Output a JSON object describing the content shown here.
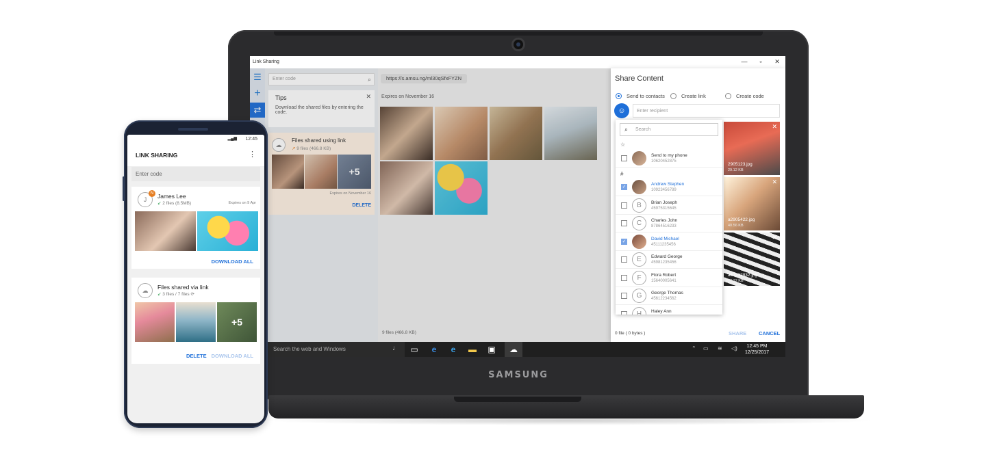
{
  "laptop": {
    "brand": "SAMSUNG",
    "window_title": "Link Sharing",
    "window_controls": {
      "minimize": "—",
      "maximize": "▫",
      "close": "✕"
    },
    "left_pane": {
      "code_placeholder": "Enter code",
      "tips_title": "Tips",
      "tips_text": "Download the shared files by entering the code.",
      "shared_card": {
        "title": "Files shared using link",
        "sub": "9 files (466.8 KB)",
        "more_count": "+5",
        "expires": "Expires on November 16",
        "delete_label": "DELETE"
      }
    },
    "center_pane": {
      "url": "https://s.amsu.ng/ml30qSfxFYZN",
      "expires": "Expires on November 16",
      "footer": "9 files (466.8 KB)"
    },
    "share_panel": {
      "title": "Share Content",
      "options": [
        "Send to contacts",
        "Create link",
        "Create code"
      ],
      "selected_option": "Send to contacts",
      "recipient_placeholder": "Enter recipient",
      "files": [
        {
          "name": "2905123.jpg",
          "size": "29.12 KB"
        },
        {
          "name": "a2905422.jpg",
          "size": "40.56 KB"
        },
        {
          "name": "a61212832.jpg",
          "size": "78.12 KB"
        }
      ],
      "footer": "0 file ( 0 bytes )",
      "share_label": "SHARE",
      "cancel_label": "CANCEL"
    },
    "contacts": {
      "search_placeholder": "Search",
      "favorites_header": "☆",
      "all_header": "#",
      "favorite": {
        "name": "Send to my phone",
        "number": "10620452875",
        "checked": false
      },
      "list": [
        {
          "name": "Andrew Stephen",
          "number": "10923456789",
          "checked": true,
          "initial": "",
          "photo": true
        },
        {
          "name": "Brian Joseph",
          "number": "45975315645",
          "checked": false,
          "initial": "B",
          "photo": false
        },
        {
          "name": "Charles John",
          "number": "87864516233",
          "checked": false,
          "initial": "C",
          "photo": false
        },
        {
          "name": "David Michael",
          "number": "45111235456",
          "checked": true,
          "initial": "",
          "photo": true
        },
        {
          "name": "Edward George",
          "number": "45981235456",
          "checked": false,
          "initial": "E",
          "photo": false
        },
        {
          "name": "Flora Robert",
          "number": "15640005641",
          "checked": false,
          "initial": "F",
          "photo": false
        },
        {
          "name": "George Thomas",
          "number": "45612234562",
          "checked": false,
          "initial": "G",
          "photo": false
        },
        {
          "name": "Haley Ann",
          "number": "",
          "checked": false,
          "initial": "H",
          "photo": false
        }
      ]
    },
    "taskbar": {
      "search_placeholder": "Search the web and Windows",
      "time": "12:45 PM",
      "date": "12/25/2017"
    }
  },
  "phone": {
    "status_time": "12:45",
    "app_title": "LINK SHARING",
    "code_placeholder": "Enter code",
    "card1": {
      "initial": "J",
      "badge": "N",
      "name": "James Lee",
      "sub": "2 files (8.5MB)",
      "expires": "Expires on 9 Apr",
      "action": "DOWNLOAD ALL"
    },
    "card2": {
      "name": "Files shared via link",
      "sub": "3 files / 7 files",
      "more_count": "+5",
      "delete_label": "DELETE",
      "action": "DOWNLOAD ALL"
    }
  },
  "colors": {
    "accent": "#1e6fd9",
    "accent_light": "#a9c5ec",
    "orange": "#e67e22"
  }
}
